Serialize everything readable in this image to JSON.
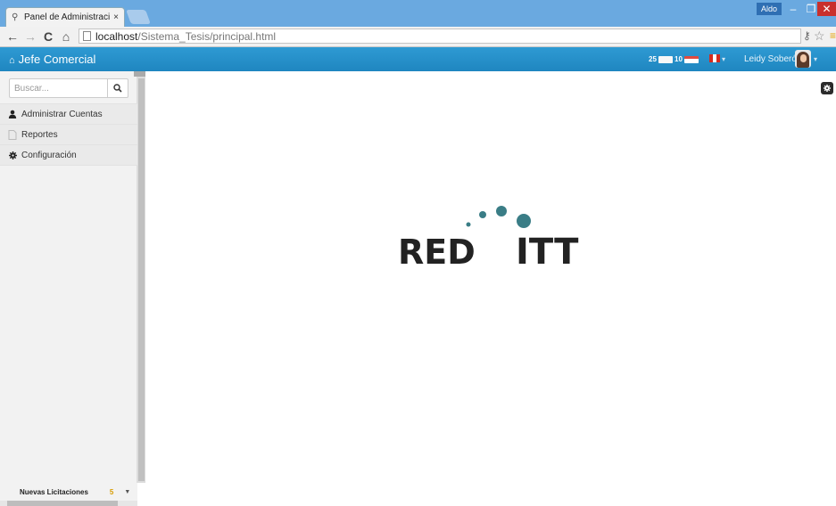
{
  "browser": {
    "tab_title": "Panel de Administración",
    "tab_close": "×",
    "profile_name": "Aldo",
    "url_host": "localhost",
    "url_path": "/Sistema_Tesis/principal.html"
  },
  "header": {
    "brand": "Jefe Comercial",
    "mail_count": "25",
    "calendar_count": "10",
    "user_name": "Leidy Soberón",
    "colors": {
      "bar": "#2191cb",
      "calendar_accent": "#e04a3f"
    }
  },
  "sidebar": {
    "search_placeholder": "Buscar...",
    "items": [
      {
        "label": "Administrar Cuentas",
        "icon": "user-icon"
      },
      {
        "label": "Reportes",
        "icon": "document-icon"
      },
      {
        "label": "Configuración",
        "icon": "gear-icon"
      }
    ],
    "footer": {
      "label": "Nuevas Licitaciones",
      "count": "5"
    }
  },
  "logo": {
    "left_word": "RED",
    "right_word": "ITT",
    "dot_color": "#3a7d86"
  }
}
